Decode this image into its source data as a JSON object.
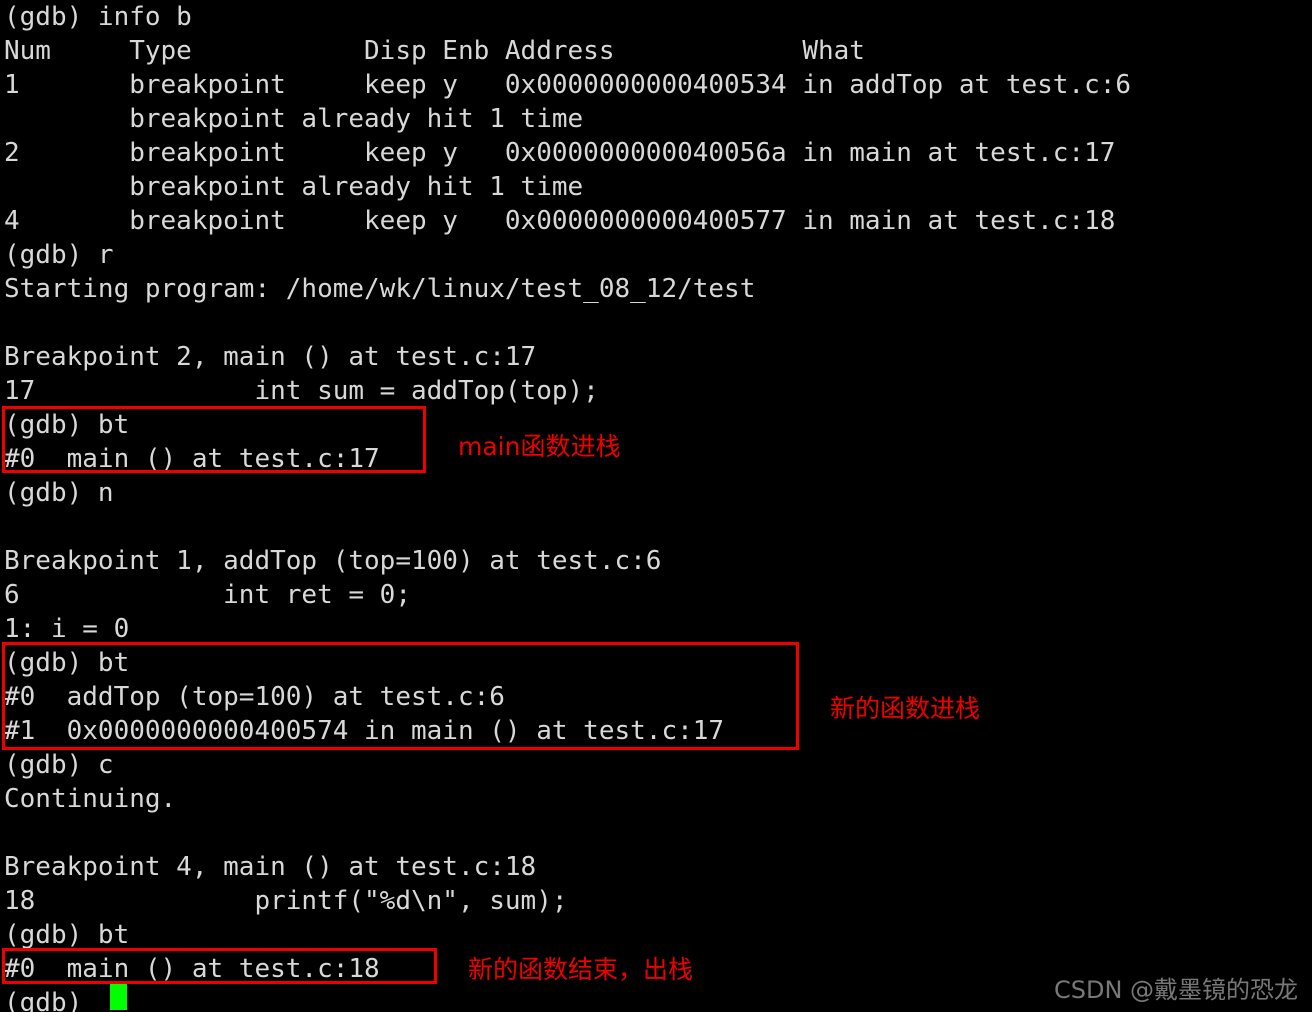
{
  "terminal": {
    "background_color": "#000000",
    "text_color": "#d8d8d8",
    "cursor_color": "#00ff00",
    "lines": [
      "(gdb) info b",
      "Num     Type           Disp Enb Address            What",
      "1       breakpoint     keep y   0x0000000000400534 in addTop at test.c:6",
      "        breakpoint already hit 1 time",
      "2       breakpoint     keep y   0x000000000040056a in main at test.c:17",
      "        breakpoint already hit 1 time",
      "4       breakpoint     keep y   0x0000000000400577 in main at test.c:18",
      "(gdb) r",
      "Starting program: /home/wk/linux/test_08_12/test",
      "",
      "Breakpoint 2, main () at test.c:17",
      "17              int sum = addTop(top);",
      "(gdb) bt",
      "#0  main () at test.c:17",
      "(gdb) n",
      "",
      "Breakpoint 1, addTop (top=100) at test.c:6",
      "6             int ret = 0;",
      "1: i = 0",
      "(gdb) bt",
      "#0  addTop (top=100) at test.c:6",
      "#1  0x0000000000400574 in main () at test.c:17",
      "(gdb) c",
      "Continuing.",
      "",
      "Breakpoint 4, main () at test.c:18",
      "18              printf(\"%d\\n\", sum);",
      "(gdb) bt",
      "#0  main () at test.c:18",
      "(gdb) "
    ]
  },
  "annotations": {
    "color": "#ee0000",
    "items": [
      {
        "text": "main函数进栈"
      },
      {
        "text": "新的函数进栈"
      },
      {
        "text": "新的函数结束，出栈"
      }
    ]
  },
  "watermark": {
    "text": "CSDN @戴墨镜的恐龙",
    "color": "#8e8e8e"
  }
}
